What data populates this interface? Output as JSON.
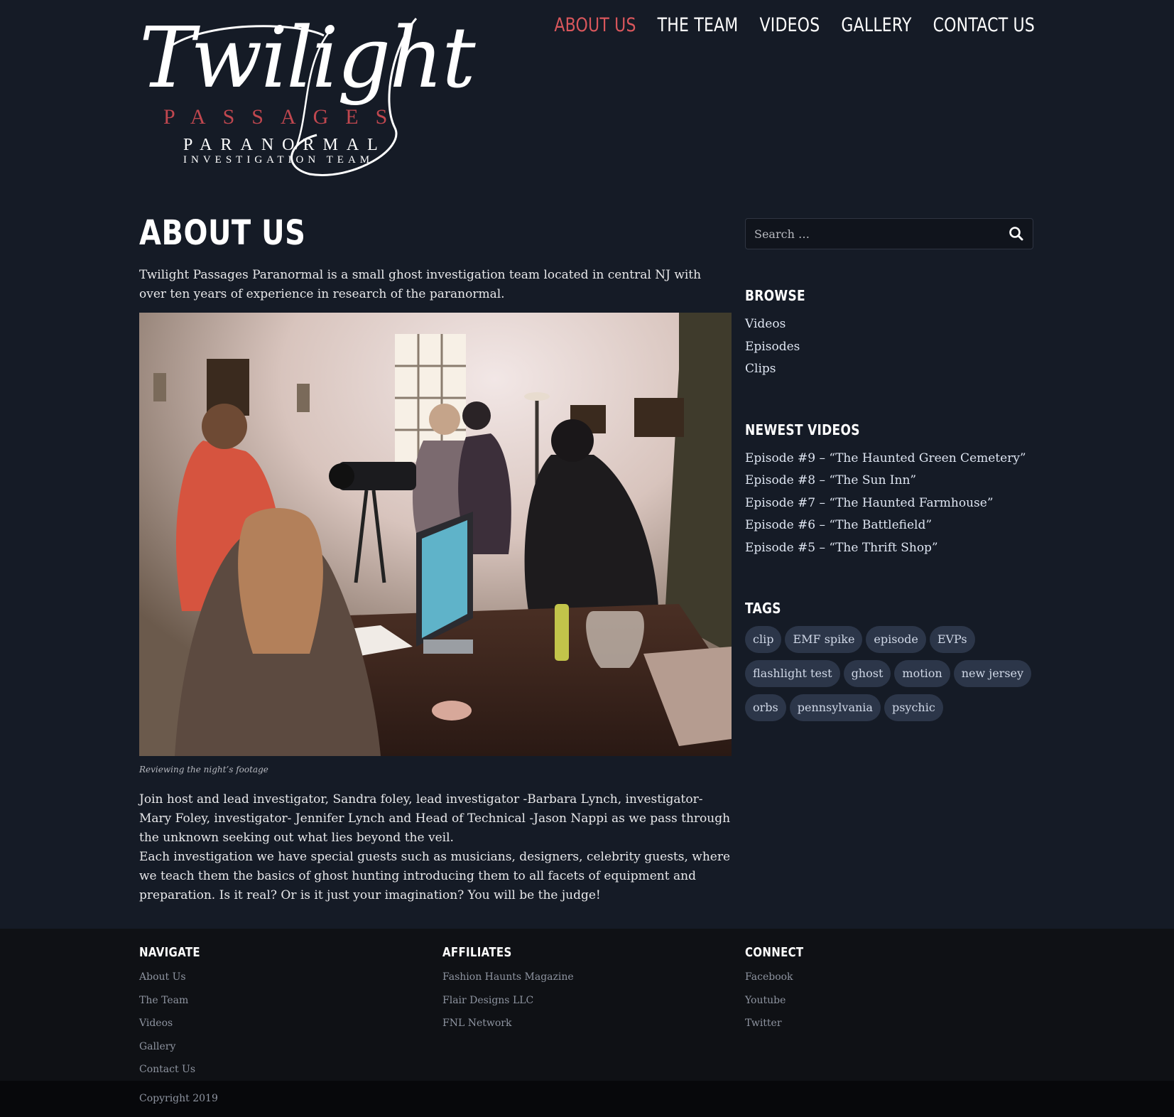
{
  "logo": {
    "script": "Twilight",
    "line1": "PASSAGES",
    "line2": "PARANORMAL",
    "line3": "INVESTIGATION TEAM"
  },
  "nav": {
    "items": [
      {
        "label": "ABOUT US",
        "active": true
      },
      {
        "label": "THE TEAM",
        "active": false
      },
      {
        "label": "VIDEOS",
        "active": false
      },
      {
        "label": "GALLERY",
        "active": false
      },
      {
        "label": "CONTACT US",
        "active": false
      }
    ],
    "active_color": "#d9575c"
  },
  "main": {
    "title": "ABOUT US",
    "intro": "Twilight Passages Paranormal is a small ghost investigation team located in central NJ with over ten years of experience in research of the paranormal.",
    "image_caption": "Reviewing the night’s footage",
    "paragraphs": [
      "Join host and lead investigator, Sandra foley, lead investigator -Barbara Lynch, investigator- Mary Foley, investigator- Jennifer Lynch and Head of Technical -Jason Nappi as we pass through the unknown seeking out what lies beyond the veil.",
      "Each investigation we have special guests such as musicians, designers, celebrity guests, where we teach them the basics of ghost hunting introducing them to all facets of equipment and preparation.  Is it real? Or is it just your imagination? You will be the judge!"
    ]
  },
  "sidebar": {
    "search": {
      "placeholder": "Search …",
      "icon": "search-icon"
    },
    "browse": {
      "title": "BROWSE",
      "items": [
        "Videos",
        "Episodes",
        "Clips"
      ]
    },
    "newest": {
      "title": "NEWEST VIDEOS",
      "items": [
        "Episode #9 – “The Haunted Green Cemetery”",
        "Episode #8 – “The Sun Inn”",
        "Episode #7 – “The Haunted Farmhouse”",
        "Episode #6 – “The Battlefield”",
        "Episode #5 – “The Thrift Shop”"
      ]
    },
    "tags": {
      "title": "TAGS",
      "items": [
        "clip",
        "EMF spike",
        "episode",
        "EVPs",
        "flashlight test",
        "ghost",
        "motion",
        "new jersey",
        "orbs",
        "pennsylvania",
        "psychic"
      ]
    }
  },
  "footer": {
    "navigate": {
      "title": "NAVIGATE",
      "items": [
        "About Us",
        "The Team",
        "Videos",
        "Gallery",
        "Contact Us"
      ]
    },
    "affiliates": {
      "title": "AFFILIATES",
      "items": [
        "Fashion Haunts Magazine",
        "Flair Designs LLC",
        "FNL Network"
      ]
    },
    "connect": {
      "title": "CONNECT",
      "items": [
        "Facebook",
        "Youtube",
        "Twitter"
      ]
    },
    "copyright": "Copyright 2019"
  },
  "colors": {
    "background": "#151b26",
    "footer": "#0f1115",
    "copyright_bar": "#07080b",
    "tag_bg": "#2c3649",
    "accent_red": "#c0474f"
  }
}
